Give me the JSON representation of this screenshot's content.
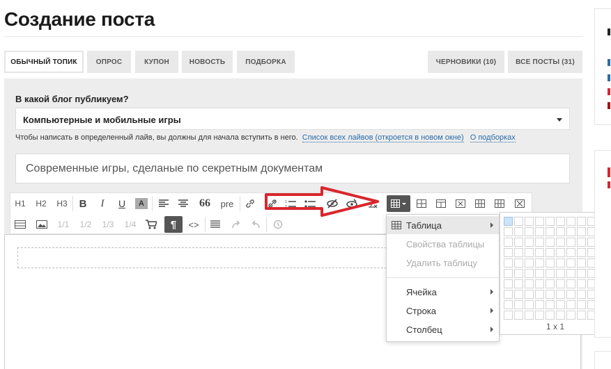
{
  "page": {
    "title": "Создание поста"
  },
  "tabs_left": [
    "Обычный топик",
    "Опрос",
    "Купон",
    "Новость",
    "Подборка"
  ],
  "tabs_right": [
    "Черновики (10)",
    "Все посты (31)"
  ],
  "form": {
    "blog_label": "В какой блог публикуем?",
    "blog_value": "Компьютерные и мобильные игры",
    "hint_text": "Чтобы написать в определенный лайв, вы должны для начала вступить в него.",
    "hint_link1": "Список всех лайвов (откроется в новом окне)",
    "hint_link2": "О подборках",
    "title_value": "Современные игры, сделаные по секретным документам"
  },
  "toolbar": {
    "h1": "H1",
    "h2": "H2",
    "h3": "H3",
    "bold": "B",
    "italic": "I",
    "underline": "U",
    "highlight": "A",
    "quote": "66",
    "pre": "pre",
    "col1": "1/1",
    "col2": "1/2",
    "col3": "1/3",
    "col4": "1/4",
    "code": "<>"
  },
  "table_menu": {
    "items": [
      {
        "label": "Таблица",
        "enabled": true,
        "submenu": true
      },
      {
        "label": "Свойства таблицы",
        "enabled": false,
        "submenu": false
      },
      {
        "label": "Удалить таблицу",
        "enabled": false,
        "submenu": false
      },
      {
        "label": "Ячейка",
        "enabled": true,
        "submenu": true
      },
      {
        "label": "Строка",
        "enabled": true,
        "submenu": true
      },
      {
        "label": "Столбец",
        "enabled": true,
        "submenu": true
      }
    ]
  },
  "table_grid": {
    "rows": 10,
    "cols": 10,
    "selected": "1 x 1"
  },
  "icons": {
    "annotation": "red-arrow-icon",
    "accent": "#d9262e"
  }
}
